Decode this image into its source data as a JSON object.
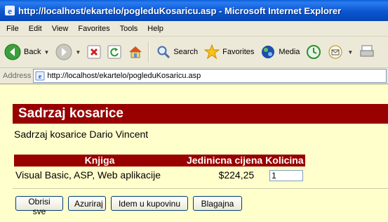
{
  "window": {
    "title": "http://localhost/ekartelo/pogleduKosaricu.asp - Microsoft Internet Explorer",
    "icon": "ie-icon"
  },
  "menu": [
    "File",
    "Edit",
    "View",
    "Favorites",
    "Tools",
    "Help"
  ],
  "toolbar": {
    "back_label": "Back",
    "search_label": "Search",
    "favorites_label": "Favorites",
    "media_label": "Media"
  },
  "address": {
    "label": "Address",
    "url": "http://localhost/ekartelo/pogleduKosaricu.asp"
  },
  "page": {
    "heading": "Sadrzaj kosarice",
    "owner_line": "Sadrzaj kosarice Dario Vincent",
    "table": {
      "headers": [
        "Knjiga",
        "Jedinicna cijena",
        "Kolicina"
      ],
      "rows": [
        {
          "book": "Visual Basic, ASP, Web aplikacije",
          "price": "$224,25",
          "qty": "1"
        }
      ]
    },
    "buttons": {
      "clear": "Obrisi sve",
      "update": "Azuriraj",
      "continue": "Idem u kupovinu",
      "checkout": "Blagajna"
    }
  },
  "colors": {
    "heading_bg": "#990000",
    "page_bg": "#ffffcc",
    "titlebar": "#0a55d0"
  }
}
